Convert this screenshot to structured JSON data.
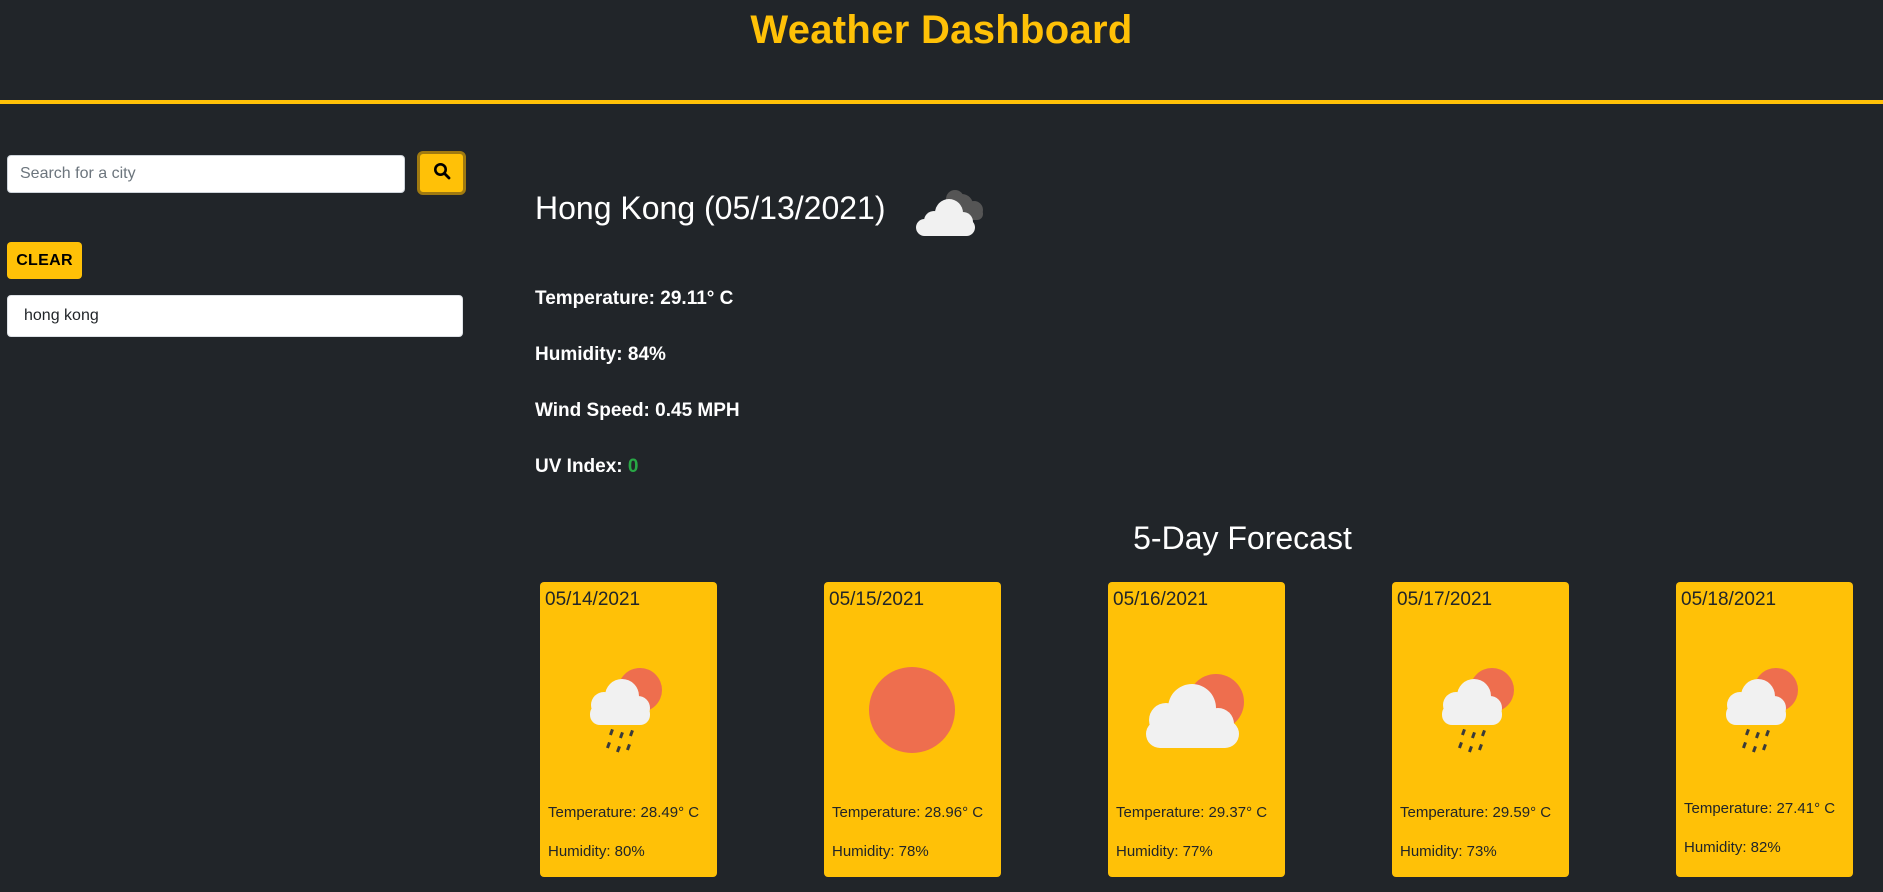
{
  "header": {
    "title": "Weather Dashboard"
  },
  "search": {
    "placeholder": "Search for a city",
    "icon": "search-icon"
  },
  "clear_label": "CLEAR",
  "history": [
    "hong kong"
  ],
  "current": {
    "title": "Hong Kong (05/13/2021)",
    "icon": "cloud-icon",
    "temperature_label": "Temperature: 29.11° C",
    "humidity_label": "Humidity: 84%",
    "wind_label": "Wind Speed: 0.45 MPH",
    "uv_label": "UV Index: ",
    "uv_value": "0",
    "uv_color": "#28a745"
  },
  "forecast": {
    "title": "5-Day Forecast",
    "days": [
      {
        "date": "05/14/2021",
        "icon": "rain-sun-icon",
        "temp": "Temperature: 28.49° C",
        "humidity": "Humidity: 80%"
      },
      {
        "date": "05/15/2021",
        "icon": "sun-icon",
        "temp": "Temperature: 28.96° C",
        "humidity": "Humidity: 78%"
      },
      {
        "date": "05/16/2021",
        "icon": "cloud-sun-icon",
        "temp": "Temperature: 29.37° C",
        "humidity": "Humidity: 77%"
      },
      {
        "date": "05/17/2021",
        "icon": "rain-sun-icon",
        "temp": "Temperature: 29.59° C",
        "humidity": "Humidity: 73%"
      },
      {
        "date": "05/18/2021",
        "icon": "rain-sun-icon",
        "temp": "Temperature: 27.41° C",
        "humidity": "Humidity: 82%"
      }
    ]
  },
  "colors": {
    "accent": "#ffc107",
    "background": "#212529",
    "sun": "#ee6e4e",
    "cloud": "#f1f1f1"
  }
}
